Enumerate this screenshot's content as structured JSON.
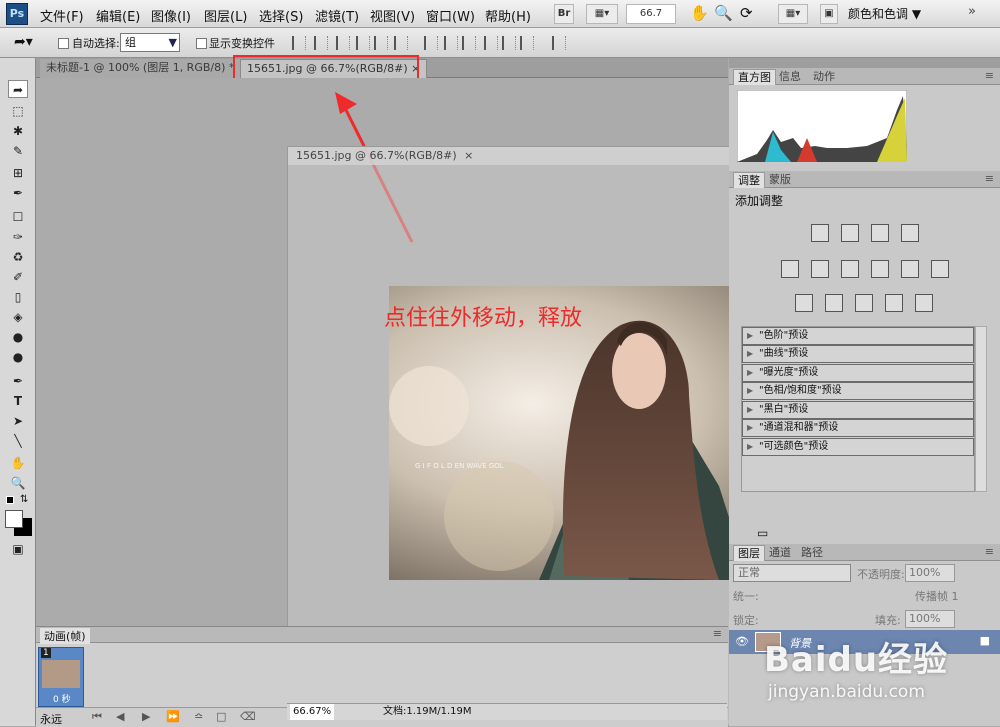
{
  "app": {
    "logo_text": "Ps"
  },
  "menu": [
    "文件(F)",
    "编辑(E)",
    "图像(I)",
    "图层(L)",
    "选择(S)",
    "滤镜(T)",
    "视图(V)",
    "窗口(W)",
    "帮助(H)"
  ],
  "menubar": {
    "br_label": "Br",
    "zoom": "66.7",
    "workspace": "颜色和色调"
  },
  "options": {
    "auto_select_label": "自动选择:",
    "auto_select_value": "组",
    "show_transform_label": "显示变换控件"
  },
  "tabs": [
    {
      "label": "未标题-1 @ 100% (图层 1, RGB/8) *"
    },
    {
      "label": "15651.jpg @ 66.7%(RGB/8#)",
      "close": "×"
    }
  ],
  "floating_window": {
    "title": "15651.jpg @ 66.7%(RGB/8#)",
    "close": "×"
  },
  "annotation": {
    "text": "点住往外移动，释放"
  },
  "photo": {
    "watermark": "G  I  F  O  L  D  EN  WAVE  GOL"
  },
  "panels": {
    "histogram_tabs": [
      "直方图",
      "信息",
      "动作"
    ],
    "adjust_tabs": [
      "调整",
      "蒙版"
    ],
    "adjust_title": "添加调整",
    "presets": [
      "\"色阶\"预设",
      "\"曲线\"预设",
      "\"曝光度\"预设",
      "\"色相/饱和度\"预设",
      "\"黑白\"预设",
      "\"通道混和器\"预设",
      "\"可选颜色\"预设"
    ],
    "layers_tabs": [
      "图层",
      "通道",
      "路径"
    ],
    "blend_mode": "正常",
    "opacity_label": "不透明度:",
    "opacity_value": "100%",
    "unify_label": "统一:",
    "propagate_label": "传播帧 1",
    "lock_label": "锁定:",
    "fill_label": "填充:",
    "fill_value": "100%",
    "layer_name": "背景"
  },
  "animation": {
    "title": "动画(帧)",
    "frame_number": "1",
    "frame_time": "0 秒",
    "loop": "永远"
  },
  "status": {
    "zoom": "66.67%",
    "doc": "文档:1.19M/1.19M"
  },
  "watermark": {
    "brand": "Baidu经验",
    "url": "jingyan.baidu.com"
  }
}
